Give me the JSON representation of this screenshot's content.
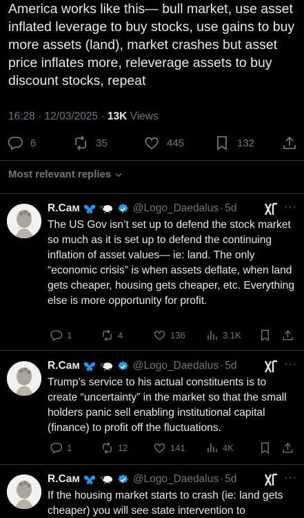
{
  "post": {
    "text": "America works like this— bull market, use asset inflated leverage to buy stocks, use gains to buy more assets (land), market crashes but asset price inflates more, releverage assets to buy discount stocks, repeat",
    "time": "16:28 · 12/03/2025 · ",
    "views_count": "13K",
    "views_label": " Views",
    "replies": "6",
    "reposts": "35",
    "likes": "445",
    "bookmarks": "132"
  },
  "replies_header": "Most relevant replies",
  "replies": [
    {
      "name": "R.Caм",
      "handle": "@Logo_Daedalus",
      "time": "5d",
      "text": "The US Gov isn’t set up to defend the stock market so much as it is set up to defend the continuing inflation of asset values— ie: land. The only “economic crisis” is when assets deflate, when land gets cheaper, housing gets cheaper, etc. Everything else is more opportunity for profit.",
      "replies": "1",
      "reposts": "4",
      "likes": "136",
      "views": "3.1K"
    },
    {
      "name": "R.Caм",
      "handle": "@Logo_Daedalus",
      "time": "5d",
      "text": "Trump’s service to his actual constituents is to create “uncertainty” in the market so that the small holders panic sell enabling institutional capital (finance) to profit off the fluctuations.",
      "replies": "1",
      "reposts": "12",
      "likes": "141",
      "views": "4K"
    },
    {
      "name": "R.Caм",
      "handle": "@Logo_Daedalus",
      "time": "5d",
      "text": "If the housing market starts to crash (ie: land gets cheaper) you will see state intervention to",
      "replies": "",
      "reposts": "",
      "likes": "",
      "views": ""
    }
  ],
  "colors": {
    "accent": "#1d9bf0",
    "muted": "#71767b",
    "text": "#e7e9ea",
    "divider": "#2f3336"
  }
}
